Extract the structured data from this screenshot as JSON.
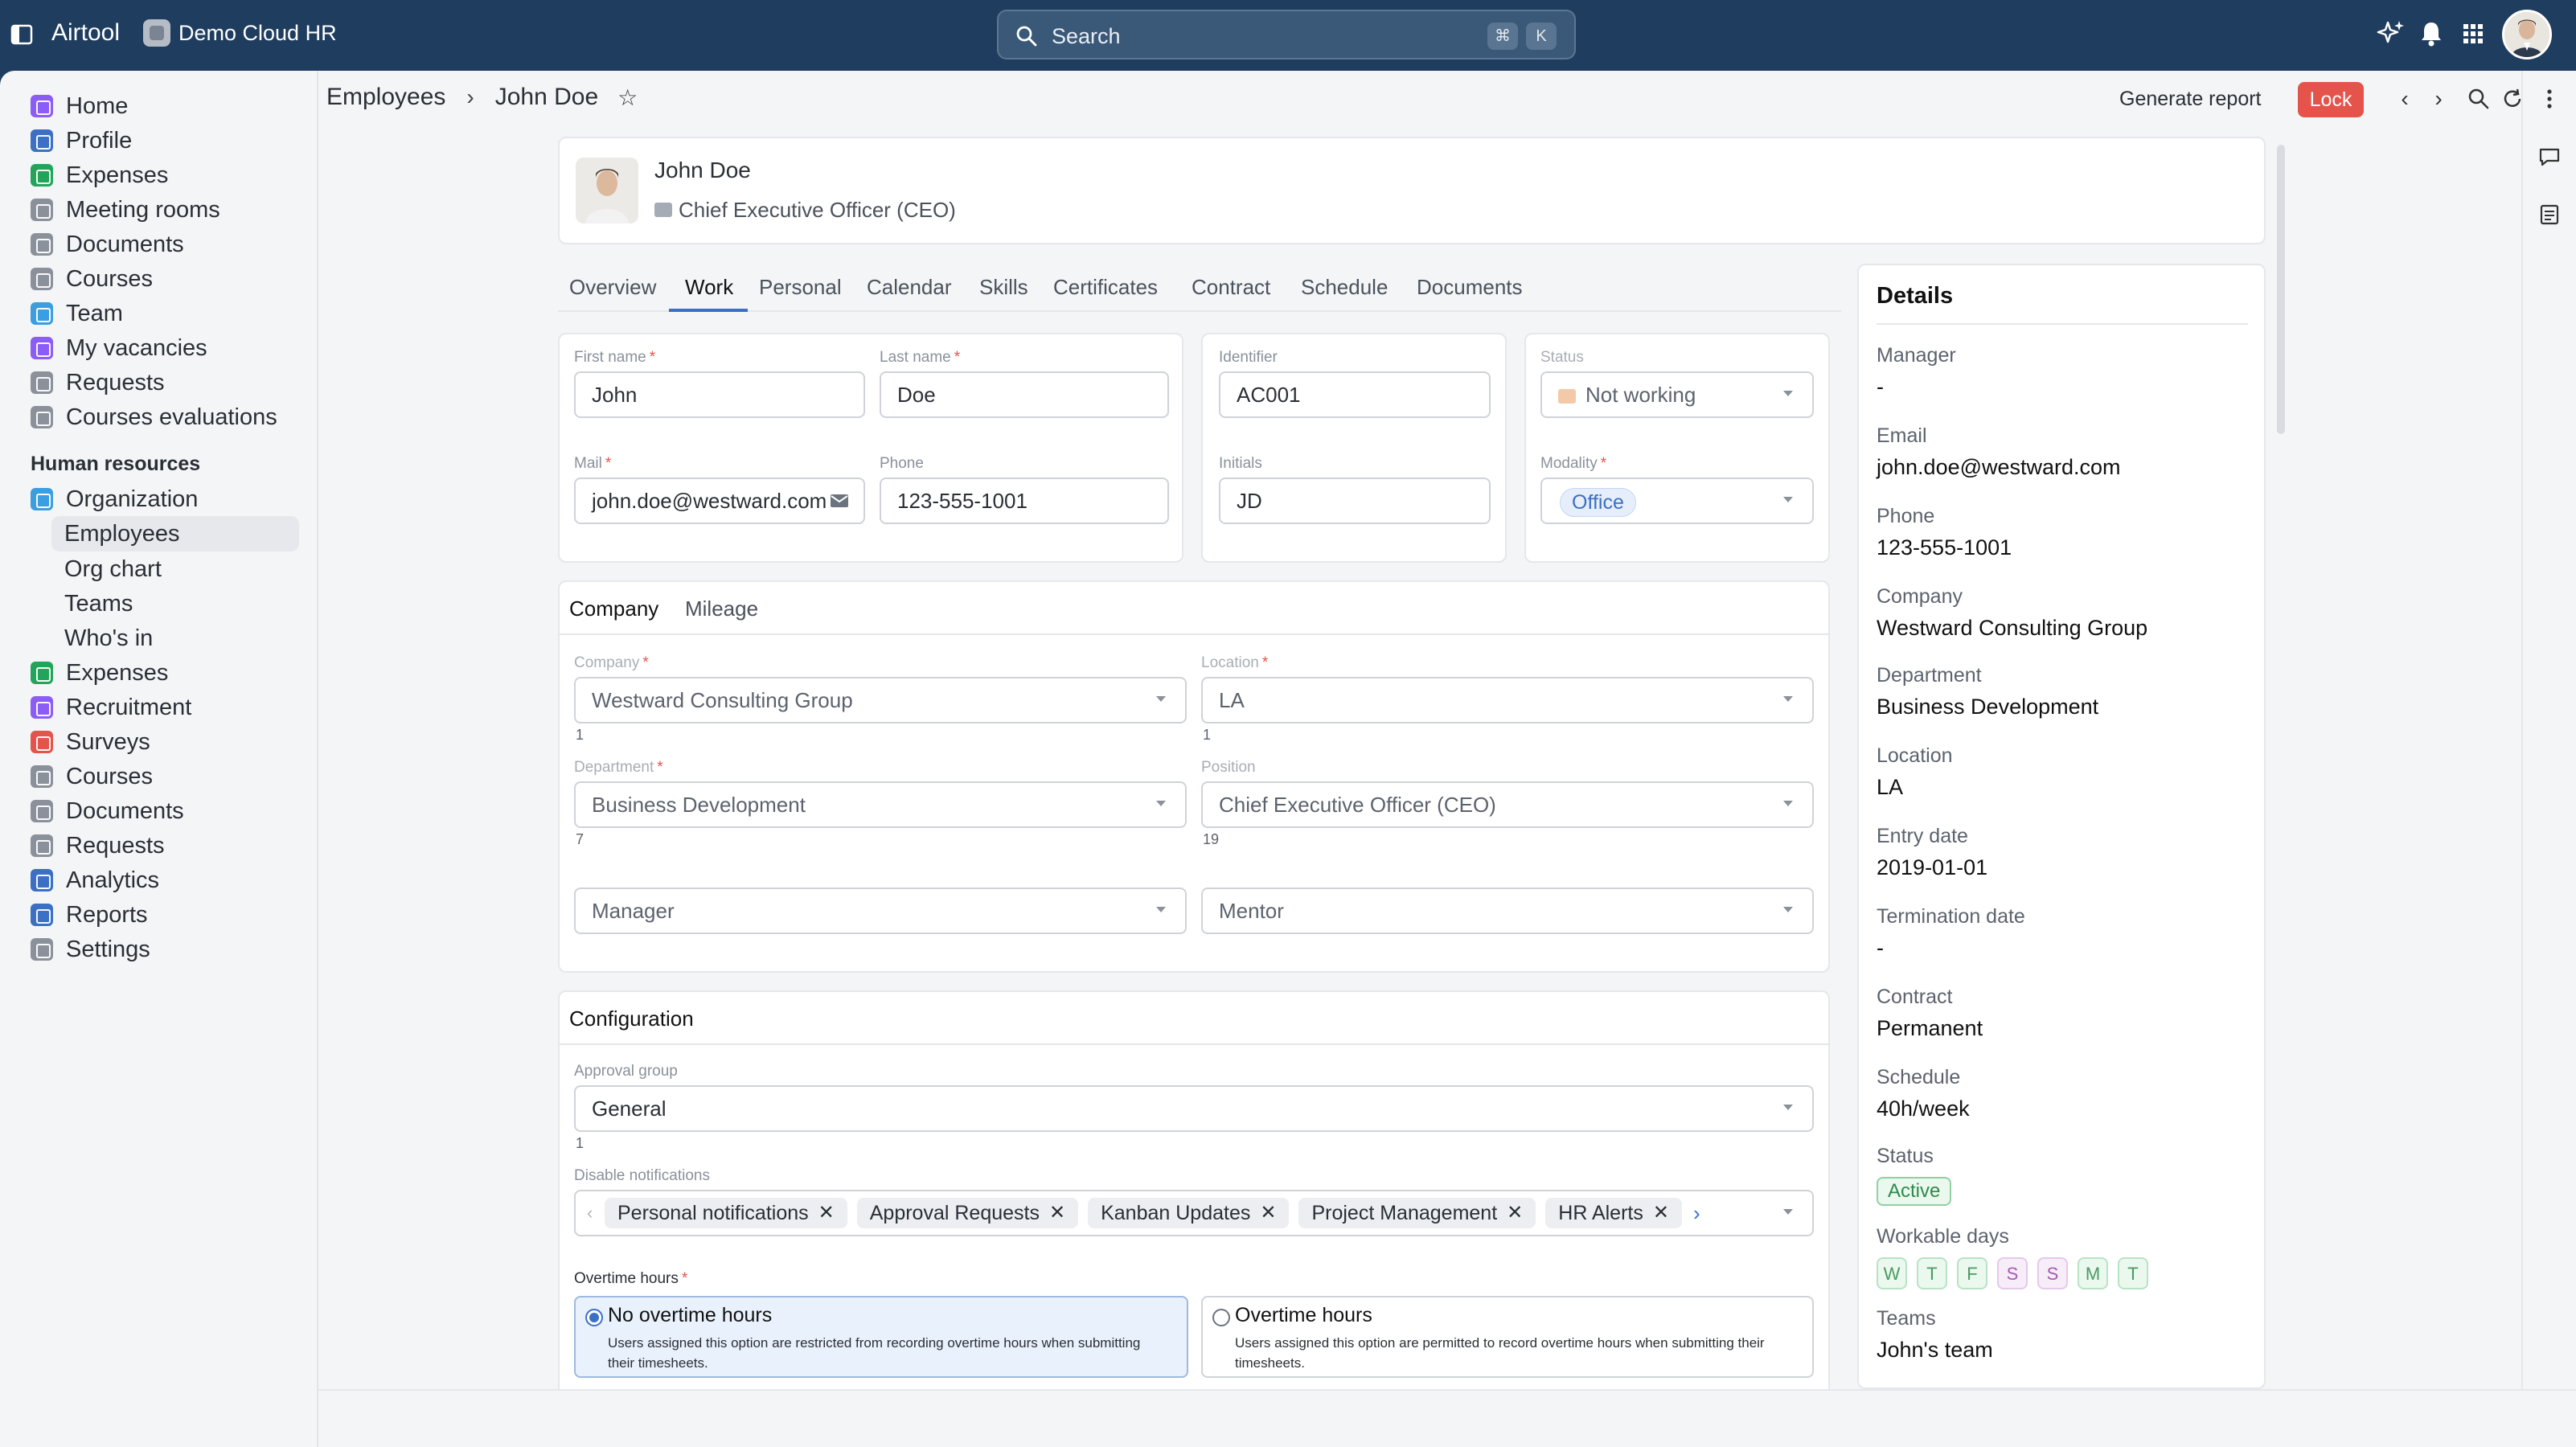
{
  "topbar": {
    "app_name": "Airtool",
    "workspace": "Demo Cloud HR",
    "search_placeholder": "Search",
    "kbd_cmd": "⌘",
    "kbd_k": "K"
  },
  "sidebar": {
    "items": [
      {
        "label": "Home",
        "color": "#8b5cf6"
      },
      {
        "label": "Profile",
        "color": "#3b70c5"
      },
      {
        "label": "Expenses",
        "color": "#22a55a"
      },
      {
        "label": "Meeting rooms",
        "color": "#8a919b"
      },
      {
        "label": "Documents",
        "color": "#8a919b"
      },
      {
        "label": "Courses",
        "color": "#8a919b"
      },
      {
        "label": "Team",
        "color": "#3b9ee0"
      },
      {
        "label": "My vacancies",
        "color": "#8b5cf6"
      },
      {
        "label": "Requests",
        "color": "#8a919b"
      },
      {
        "label": "Courses evaluations",
        "color": "#8a919b"
      }
    ],
    "section_title": "Human resources",
    "hr_items": [
      {
        "label": "Organization",
        "color": "#3b9ee0"
      },
      {
        "label": "Employees"
      },
      {
        "label": "Org chart"
      },
      {
        "label": "Teams"
      },
      {
        "label": "Who's in"
      },
      {
        "label": "Expenses",
        "color": "#22a55a"
      },
      {
        "label": "Recruitment",
        "color": "#8b5cf6"
      },
      {
        "label": "Surveys",
        "color": "#e5544a"
      },
      {
        "label": "Courses",
        "color": "#8a919b"
      },
      {
        "label": "Documents",
        "color": "#8a919b"
      },
      {
        "label": "Requests",
        "color": "#8a919b"
      },
      {
        "label": "Analytics",
        "color": "#3b70c5"
      },
      {
        "label": "Reports",
        "color": "#3b70c5"
      },
      {
        "label": "Settings",
        "color": "#8a919b"
      }
    ]
  },
  "header": {
    "breadcrumb_root": "Employees",
    "breadcrumb_current": "John Doe",
    "generate_report": "Generate report",
    "lock": "Lock"
  },
  "profile": {
    "name": "John Doe",
    "title": "Chief Executive Officer (CEO)"
  },
  "tabs": [
    "Overview",
    "Work",
    "Personal",
    "Calendar",
    "Skills",
    "Certificates",
    "Contract",
    "Schedule",
    "Documents"
  ],
  "form": {
    "first_name_label": "First name",
    "first_name": "John",
    "last_name_label": "Last name",
    "last_name": "Doe",
    "mail_label": "Mail",
    "mail": "john.doe@westward.com",
    "phone_label": "Phone",
    "phone": "123-555-1001",
    "identifier_label": "Identifier",
    "identifier": "AC001",
    "initials_label": "Initials",
    "initials": "JD",
    "status_label": "Status",
    "status": "Not working",
    "modality_label": "Modality",
    "modality": "Office"
  },
  "company_section": {
    "tab_company": "Company",
    "tab_mileage": "Mileage",
    "company_label": "Company",
    "company": "Westward Consulting Group",
    "company_hint": "1",
    "location_label": "Location",
    "location": "LA",
    "location_hint": "1",
    "department_label": "Department",
    "department": "Business Development",
    "department_hint": "7",
    "position_label": "Position",
    "position": "Chief Executive Officer (CEO)",
    "position_hint": "19",
    "manager_placeholder": "Manager",
    "mentor_placeholder": "Mentor"
  },
  "configuration": {
    "title": "Configuration",
    "approval_group_label": "Approval group",
    "approval_group": "General",
    "approval_hint": "1",
    "disable_notifications_label": "Disable notifications",
    "chips": [
      "Personal notifications",
      "Approval Requests",
      "Kanban Updates",
      "Project Management",
      "HR Alerts"
    ],
    "overtime_label": "Overtime hours",
    "option_no_title": "No overtime hours",
    "option_no_desc": "Users assigned this option are restricted from recording overtime hours when submitting their timesheets.",
    "option_yes_title": "Overtime hours",
    "option_yes_desc": "Users assigned this option are permitted to record overtime hours when submitting their timesheets."
  },
  "details": {
    "title": "Details",
    "manager_label": "Manager",
    "manager": "-",
    "email_label": "Email",
    "email": "john.doe@westward.com",
    "phone_label": "Phone",
    "phone": "123-555-1001",
    "company_label": "Company",
    "company": "Westward Consulting Group",
    "department_label": "Department",
    "department": "Business Development",
    "location_label": "Location",
    "location": "LA",
    "entry_date_label": "Entry date",
    "entry_date": "2019-01-01",
    "termination_date_label": "Termination date",
    "termination_date": "-",
    "contract_label": "Contract",
    "contract": "Permanent",
    "schedule_label": "Schedule",
    "schedule": "40h/week",
    "status_label": "Status",
    "status": "Active",
    "workable_days_label": "Workable days",
    "workable_days": [
      "W",
      "T",
      "F",
      "S",
      "S",
      "M",
      "T"
    ],
    "teams_label": "Teams",
    "teams": "John's team"
  },
  "colors": {
    "topbar": "#1f3d5e",
    "accent": "#3b70c5",
    "lock": "#e5544a",
    "active_green": "#2f8a4b"
  }
}
